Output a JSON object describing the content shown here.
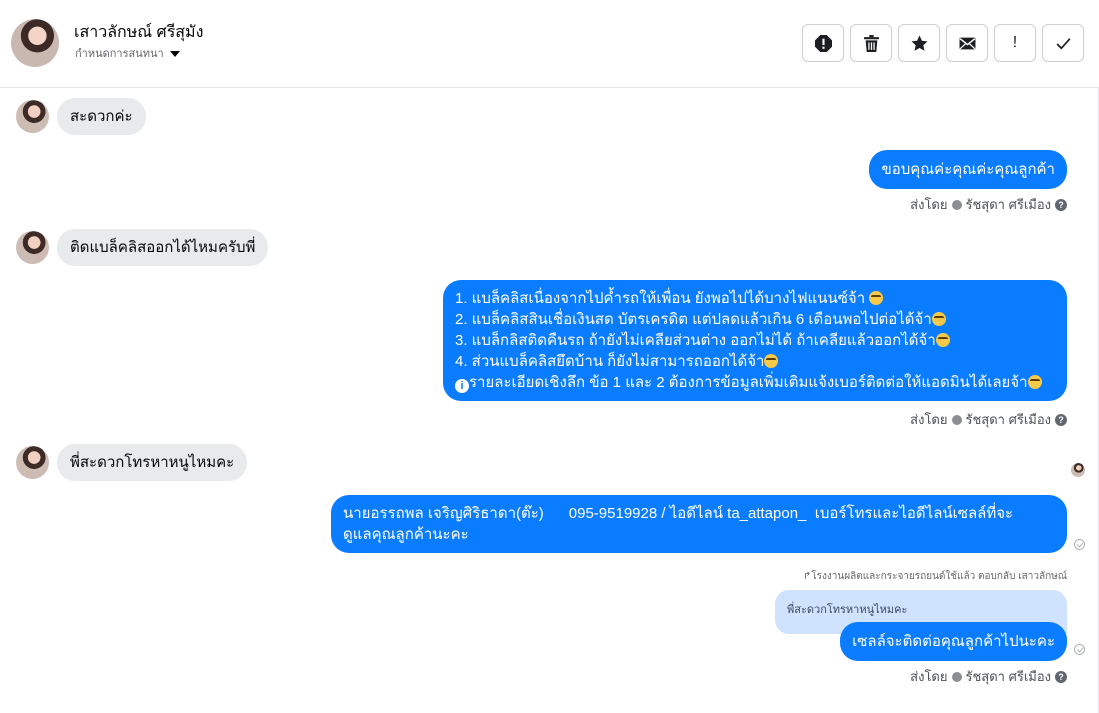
{
  "header": {
    "contact_name": "เสาวลักษณ์ ศรีสุมัง",
    "subtitle": "กำหนดการสนทนา"
  },
  "toolbar": {
    "buttons": [
      "report-icon",
      "trash-icon",
      "star-icon",
      "mail-icon",
      "exclamation-icon",
      "check-icon"
    ],
    "exclamation_label": "!"
  },
  "messages": {
    "m1": "สะดวกค่ะ",
    "m2": "ขอบคุณค่ะคุณค่ะคุณลูกค้า",
    "m3": "ติดแบล็คลิสออกได้ไหมครับพี่",
    "m4": {
      "line1": "1. แบล็คลิสเนื่องจากไปค้ำรถให้เพื่อน ยังพอไปได้บางไฟแนนซ์จ้า",
      "line2": "2. แบล็คลิสสินเชื่อเงินสด บัตรเครดิต แต่ปลดแล้วเกิน 6 เดือนพอไปต่อได้จ้า",
      "line3": "3. แบล็กลิสติดคืนรถ ถ้ายังไม่เคลียส่วนต่าง ออกไม่ได้ ถ้าเคลียแล้วออกได้จ้า",
      "line4": "4. ส่วนแบล็คลิสยึดบ้าน ก็ยังไม่สามารถออกได้จ้า",
      "line5": "รายละเอียดเชิงลึก ข้อ 1 และ 2 ต้องการข้อมูลเพิ่มเติมแจ้งเบอร์ติดต่อให้แอดมินได้เลยจ้า"
    },
    "m5": "พี่สะดวกโทรหาหนูไหมคะ",
    "m6": {
      "line1": "นายอรรถพล เจริญศิริธาดา(ต๊ะ)      095-9519928 / ไอดีไลน์ ta_attapon_  เบอร์โทรและไอดีไลน์เซลล์ที่จะ",
      "line2": "ดูแลคุณลูกค้านะคะ"
    },
    "reply_hint": "โรงงานผลิตและกระจายรถยนต์ใช้แล้ว ตอบกลับ เสาวลักษณ์",
    "quoted": "พี่สะดวกโทรหาหนูไหมคะ",
    "m7": "เซลล์จะติดต่อคุณลูกค้าไปนะคะ"
  },
  "sent_by": {
    "prefix": "ส่งโดย",
    "agent": "รัชสุดา ศรีเมือง"
  }
}
